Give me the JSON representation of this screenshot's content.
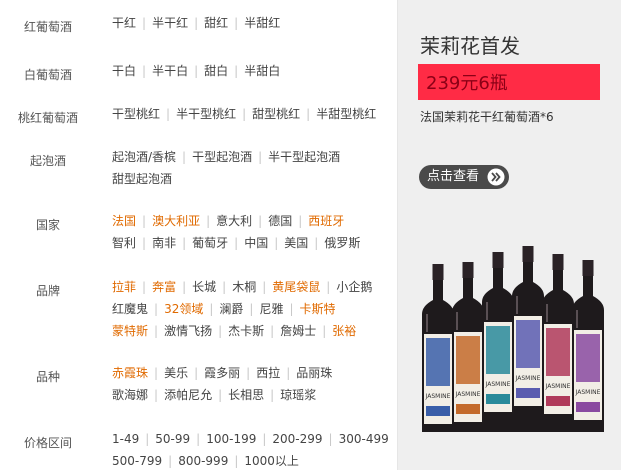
{
  "filters": [
    {
      "label": "红葡萄酒",
      "lines": [
        [
          {
            "t": "干红"
          },
          {
            "t": "半干红"
          },
          {
            "t": "甜红"
          },
          {
            "t": "半甜红"
          }
        ]
      ]
    },
    {
      "label": "白葡萄酒",
      "lines": [
        [
          {
            "t": "干白"
          },
          {
            "t": "半干白"
          },
          {
            "t": "甜白"
          },
          {
            "t": "半甜白"
          }
        ]
      ]
    },
    {
      "label": "桃红葡萄酒",
      "lines": [
        [
          {
            "t": "干型桃红"
          },
          {
            "t": "半干型桃红"
          },
          {
            "t": "甜型桃红"
          },
          {
            "t": "半甜型桃红"
          }
        ]
      ]
    },
    {
      "label": "起泡酒",
      "lines": [
        [
          {
            "t": "起泡酒/香槟"
          },
          {
            "t": "干型起泡酒"
          },
          {
            "t": "半干型起泡酒"
          }
        ],
        [
          {
            "t": "甜型起泡酒"
          }
        ]
      ]
    },
    {
      "label": "国家",
      "lines": [
        [
          {
            "t": "法国",
            "hot": true
          },
          {
            "t": "澳大利亚",
            "hot": true
          },
          {
            "t": "意大利"
          },
          {
            "t": "德国"
          },
          {
            "t": "西班牙",
            "hot": true
          }
        ],
        [
          {
            "t": "智利"
          },
          {
            "t": "南非"
          },
          {
            "t": "葡萄牙"
          },
          {
            "t": "中国"
          },
          {
            "t": "美国"
          },
          {
            "t": "俄罗斯"
          }
        ]
      ]
    },
    {
      "label": "品牌",
      "lines": [
        [
          {
            "t": "拉菲",
            "hot": true
          },
          {
            "t": "奔富",
            "hot": true
          },
          {
            "t": "长城"
          },
          {
            "t": "木桐"
          },
          {
            "t": "黄尾袋鼠",
            "hot": true
          },
          {
            "t": "小企鹅"
          }
        ],
        [
          {
            "t": "红魔鬼"
          },
          {
            "t": "32领域",
            "hot": true
          },
          {
            "t": "澜爵"
          },
          {
            "t": "尼雅"
          },
          {
            "t": "卡斯特",
            "hot": true
          }
        ],
        [
          {
            "t": "蒙特斯",
            "hot": true
          },
          {
            "t": "激情飞扬"
          },
          {
            "t": "杰卡斯"
          },
          {
            "t": "詹姆士"
          },
          {
            "t": "张裕",
            "hot": true
          }
        ]
      ]
    },
    {
      "label": "品种",
      "lines": [
        [
          {
            "t": "赤霞珠",
            "hot": true
          },
          {
            "t": "美乐"
          },
          {
            "t": "霞多丽"
          },
          {
            "t": "西拉"
          },
          {
            "t": "品丽珠"
          }
        ],
        [
          {
            "t": "歌海娜"
          },
          {
            "t": "添帕尼允"
          },
          {
            "t": "长相思"
          },
          {
            "t": "琼瑶浆"
          }
        ]
      ]
    },
    {
      "label": "价格区间",
      "lines": [
        [
          {
            "t": "1-49"
          },
          {
            "t": "50-99"
          },
          {
            "t": "100-199"
          },
          {
            "t": "200-299"
          },
          {
            "t": "300-499"
          }
        ],
        [
          {
            "t": "500-799"
          },
          {
            "t": "800-999"
          },
          {
            "t": "1000以上"
          }
        ]
      ]
    }
  ],
  "promo": {
    "title": "茉莉花首发",
    "price": "239元6瓶",
    "desc": "法国茉莉花干红葡萄酒*6",
    "button": "点击查看",
    "bottle_label": "JASMINE",
    "colors": {
      "price_bg": "#ff2b45",
      "price_text": "#8b0016",
      "hot": "#e06a00"
    }
  }
}
